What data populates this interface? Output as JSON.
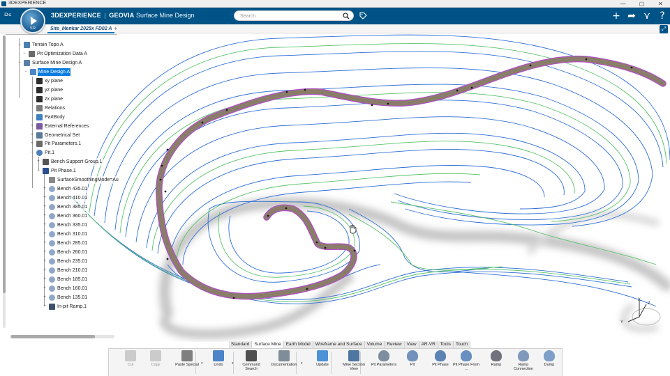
{
  "window": {
    "title": "3DEXPERIENCE",
    "controls": [
      "—",
      "▢",
      "✕"
    ]
  },
  "header": {
    "brand": "3DEXPERIENCE",
    "separator": "|",
    "product": "GEOVIA",
    "app_name": "Surface Mine Design",
    "search_placeholder": "Search",
    "compass_version": "V.R",
    "accent_color": "#005386"
  },
  "tabs": {
    "active_document": "Site_Menkar 2025x FD02 A",
    "add_label": "+"
  },
  "tree": {
    "nodes": [
      {
        "label": "Terrain Topo A",
        "icon": "terrain-icon"
      },
      {
        "label": "Pit Optimization Data A",
        "icon": "data-icon"
      },
      {
        "label": "Surface Mine Design A",
        "icon": "mine-design-icon"
      },
      {
        "label": "Mine Design A",
        "icon": "design-icon",
        "selected": true
      },
      {
        "label": "xy plane",
        "icon": "plane-icon"
      },
      {
        "label": "yz plane",
        "icon": "plane-icon"
      },
      {
        "label": "zx plane",
        "icon": "plane-icon"
      },
      {
        "label": "Relations",
        "icon": "relations-icon"
      },
      {
        "label": "PartBody",
        "icon": "partbody-icon"
      },
      {
        "label": "External References",
        "icon": "external-icon"
      },
      {
        "label": "Geometrical Set",
        "icon": "geoset-icon"
      },
      {
        "label": "Pit Parameters.1",
        "icon": "parameters-icon"
      },
      {
        "label": "Pit.1",
        "icon": "pit-icon"
      },
      {
        "label": "Bench Support Group.1",
        "icon": "group-icon"
      },
      {
        "label": "Pit Phase.1",
        "icon": "phase-icon"
      },
      {
        "label": "SurfaceSmoothingMode=Au",
        "icon": "param-icon"
      },
      {
        "label": "Bench 435.01",
        "icon": "bench-icon"
      },
      {
        "label": "Bench 410.01",
        "icon": "bench-icon"
      },
      {
        "label": "Bench 385.01",
        "icon": "bench-icon"
      },
      {
        "label": "Bench 360.01",
        "icon": "bench-icon"
      },
      {
        "label": "Bench 335.01",
        "icon": "bench-icon"
      },
      {
        "label": "Bench 310.01",
        "icon": "bench-icon"
      },
      {
        "label": "Bench 285.01",
        "icon": "bench-icon"
      },
      {
        "label": "Bench 260.01",
        "icon": "bench-icon"
      },
      {
        "label": "Bench 235.01",
        "icon": "bench-icon"
      },
      {
        "label": "Bench 210.01",
        "icon": "bench-icon"
      },
      {
        "label": "Bench 185.01",
        "icon": "bench-icon"
      },
      {
        "label": "Bench 160.01",
        "icon": "bench-icon"
      },
      {
        "label": "Bench 135.01",
        "icon": "bench-icon"
      },
      {
        "label": "In-pit Ramp.1",
        "icon": "ramp-icon"
      }
    ]
  },
  "ribbon": {
    "tabs": [
      "Standard",
      "Surface Mine",
      "Earth Model",
      "Wireframe and Surface",
      "Volume",
      "Review",
      "View",
      "AR-VR",
      "Tools",
      "Touch"
    ],
    "active_tab": "Surface Mine",
    "commands": [
      {
        "label": "Cut",
        "icon": "cut-icon",
        "enabled": false
      },
      {
        "label": "Copy",
        "icon": "copy-icon",
        "enabled": false
      },
      {
        "label": "Paste Special",
        "icon": "paste-icon",
        "enabled": true
      },
      {
        "label": "Undo",
        "icon": "undo-icon",
        "enabled": true
      },
      {
        "label": "Command Search",
        "icon": "command-search-icon",
        "enabled": true
      },
      {
        "label": "Documentation",
        "icon": "documentation-icon",
        "enabled": true
      },
      {
        "label": "Update",
        "icon": "update-icon",
        "enabled": true
      },
      {
        "label": "Mine Section View",
        "icon": "section-view-icon",
        "enabled": true
      },
      {
        "label": "Pit Parameters",
        "icon": "pit-parameters-icon",
        "enabled": true
      },
      {
        "label": "Pit",
        "icon": "pit-cmd-icon",
        "enabled": true
      },
      {
        "label": "Pit Phase",
        "icon": "pit-phase-icon",
        "enabled": true
      },
      {
        "label": "Pit Phase From ...",
        "icon": "pit-phase-from-icon",
        "enabled": true
      },
      {
        "label": "Ramp",
        "icon": "ramp-cmd-icon",
        "enabled": true
      },
      {
        "label": "Ramp Connection",
        "icon": "ramp-connection-icon",
        "enabled": true
      },
      {
        "label": "Dump",
        "icon": "dump-icon",
        "enabled": true
      }
    ]
  },
  "triad": {
    "x": "X",
    "y": "Y",
    "z": "Z"
  },
  "colors": {
    "contour_blue": "#2f6fd6",
    "contour_green": "#59c26a",
    "ramp_fill": "#8a7d6a",
    "ramp_edge": "#b050c8"
  }
}
